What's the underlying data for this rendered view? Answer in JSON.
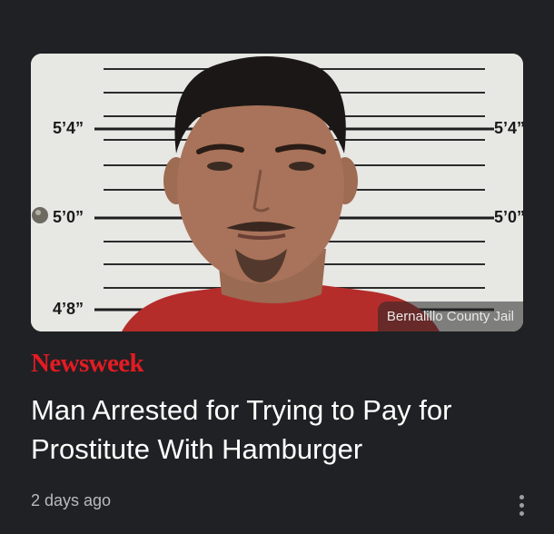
{
  "article": {
    "image_alt": "Booking photo of a man in front of a height chart",
    "height_marks": [
      "5’4”",
      "5’0”",
      "4’8”"
    ],
    "image_credit": "Bernalillo County Jail",
    "source": "Newsweek",
    "headline": "Man Arrested for Trying to Pay for Prostitute With Hamburger",
    "time_ago": "2 days ago",
    "menu_icon": "more-vert-icon"
  },
  "colors": {
    "background": "#202124",
    "source_red": "#e41b23",
    "headline": "#ffffff",
    "meta": "#b8babe"
  }
}
